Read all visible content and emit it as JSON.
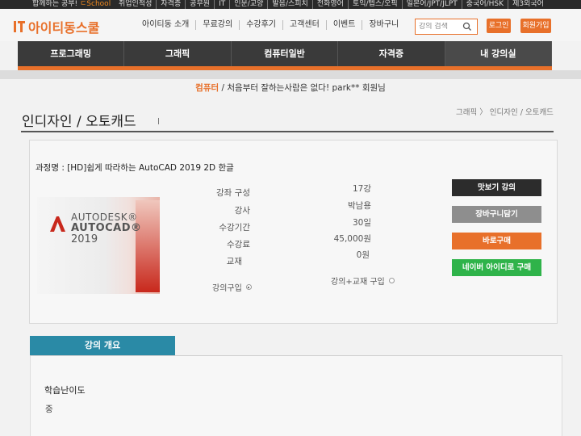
{
  "topstrip": {
    "promo_text": "합께하는 공부!",
    "promo_brand": "ㄷSchool",
    "links": [
      "취업인적성",
      "자격증",
      "공무원",
      "IT",
      "인문/교양",
      "발음/스피치",
      "전화영어",
      "토익/텝스/오픽",
      "일본어/JPT/JLPT",
      "중국어/HSK",
      "제3외국어"
    ]
  },
  "header": {
    "logo_text": "아이티동스쿨",
    "nav": [
      "아이티동 소개",
      "무료강의",
      "수강후기",
      "고객센터",
      "이벤트",
      "장바구니"
    ],
    "search_placeholder": "강의 검색",
    "login_label": "로그인",
    "join_label": "회원가입"
  },
  "categories": [
    {
      "label": "프로그래밍",
      "active": false
    },
    {
      "label": "그래픽",
      "active": false
    },
    {
      "label": "컴퓨터일반",
      "active": false
    },
    {
      "label": "자격증",
      "active": false
    },
    {
      "label": "내 강의실",
      "active": true
    }
  ],
  "welcome": {
    "category": "컴퓨터",
    "slogan": " / 처음부터 잘하는사람은 없다! park** 회원님"
  },
  "page": {
    "title": "인디자인 / 오토캐드",
    "breadcrumb": "그래픽 〉 인디자인 / 오토캐드"
  },
  "course": {
    "name": "과정명 : [HD]쉽게 따라하는 AutoCAD 2019 2D 한글",
    "thumbnail": {
      "brand": "AUTODESK®",
      "product": "AUTOCAD®",
      "year": "2019"
    },
    "info": [
      {
        "label": "강좌 구성",
        "value": "17강"
      },
      {
        "label": "강사",
        "value": "박남용"
      },
      {
        "label": "수강기간",
        "value": "30일"
      },
      {
        "label": "수강료",
        "value": "45,000원"
      },
      {
        "label": "교재",
        "value": "0원"
      }
    ],
    "purchase_options": [
      {
        "label": "강의구입",
        "checked": true
      },
      {
        "label": "강의+교재 구입",
        "checked": false
      }
    ],
    "buttons": {
      "preview": "맛보기 강의",
      "cart": "장바구니담기",
      "buy": "바로구매",
      "naver": "네이버 아이디로 구매"
    }
  },
  "overview": {
    "tab_label": "강의 개요",
    "difficulty_label": "학습난이도",
    "difficulty_value": "중"
  },
  "colors": {
    "accent": "#e8702a",
    "dark_bar": "#3a3a3a",
    "teal": "#2a8aa6",
    "naver_green": "#2fb34a"
  }
}
